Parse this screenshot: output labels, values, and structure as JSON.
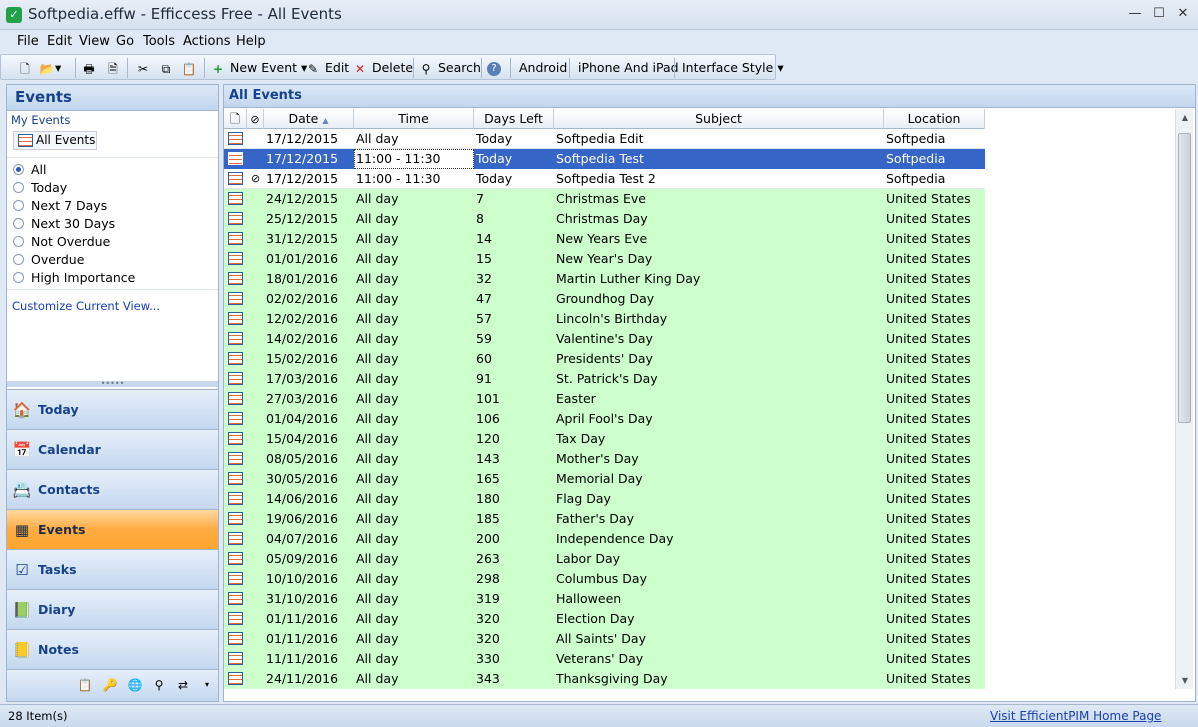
{
  "window": {
    "title": "Softpedia.effw - Efficcess Free - All Events",
    "app_icon": "check-icon",
    "controls": [
      "minimize-icon",
      "maximize-icon",
      "close-icon"
    ]
  },
  "menu": [
    "File",
    "Edit",
    "View",
    "Go",
    "Tools",
    "Actions",
    "Help"
  ],
  "toolbar": {
    "new_event": "New Event",
    "edit": "Edit",
    "delete": "Delete",
    "search": "Search",
    "android": "Android",
    "iphone": "iPhone And iPad",
    "interface_style": "Interface Style"
  },
  "sidebar": {
    "title": "Events",
    "my_events_label": "My Events",
    "all_events_label": "All Events",
    "filters": [
      {
        "label": "All",
        "selected": true
      },
      {
        "label": "Today",
        "selected": false
      },
      {
        "label": "Next 7 Days",
        "selected": false
      },
      {
        "label": "Next 30 Days",
        "selected": false
      },
      {
        "label": "Not Overdue",
        "selected": false
      },
      {
        "label": "Overdue",
        "selected": false
      },
      {
        "label": "High Importance",
        "selected": false
      }
    ],
    "customize_link": "Customize Current View..."
  },
  "navigation": [
    {
      "label": "Today",
      "icon": "home-icon",
      "active": false
    },
    {
      "label": "Calendar",
      "icon": "calendar-icon",
      "active": false
    },
    {
      "label": "Contacts",
      "icon": "contacts-icon",
      "active": false
    },
    {
      "label": "Events",
      "icon": "events-icon",
      "active": true
    },
    {
      "label": "Tasks",
      "icon": "tasks-icon",
      "active": false
    },
    {
      "label": "Diary",
      "icon": "diary-icon",
      "active": false
    },
    {
      "label": "Notes",
      "icon": "notes-icon",
      "active": false
    }
  ],
  "main": {
    "title": "All Events",
    "columns": [
      "Date",
      "Time",
      "Days Left",
      "Subject",
      "Location"
    ],
    "rows": [
      {
        "date": "17/12/2015",
        "time": "All day",
        "days_left": "Today",
        "subject": "Softpedia Edit",
        "location": "Softpedia",
        "style": "white",
        "attachment": false
      },
      {
        "date": "17/12/2015",
        "time": "11:00 - 11:30",
        "days_left": "Today",
        "subject": "Softpedia Test",
        "location": "Softpedia",
        "style": "sel",
        "attachment": false
      },
      {
        "date": "17/12/2015",
        "time": "11:00 - 11:30",
        "days_left": "Today",
        "subject": "Softpedia Test 2",
        "location": "Softpedia",
        "style": "white",
        "attachment": true
      },
      {
        "date": "24/12/2015",
        "time": "All day",
        "days_left": "7",
        "subject": "Christmas Eve",
        "location": "United States",
        "style": "green",
        "attachment": false
      },
      {
        "date": "25/12/2015",
        "time": "All day",
        "days_left": "8",
        "subject": "Christmas Day",
        "location": "United States",
        "style": "green",
        "attachment": false
      },
      {
        "date": "31/12/2015",
        "time": "All day",
        "days_left": "14",
        "subject": "New Years Eve",
        "location": "United States",
        "style": "green",
        "attachment": false
      },
      {
        "date": "01/01/2016",
        "time": "All day",
        "days_left": "15",
        "subject": "New Year's Day",
        "location": "United States",
        "style": "green",
        "attachment": false
      },
      {
        "date": "18/01/2016",
        "time": "All day",
        "days_left": "32",
        "subject": "Martin Luther King Day",
        "location": "United States",
        "style": "green",
        "attachment": false
      },
      {
        "date": "02/02/2016",
        "time": "All day",
        "days_left": "47",
        "subject": "Groundhog Day",
        "location": "United States",
        "style": "green",
        "attachment": false
      },
      {
        "date": "12/02/2016",
        "time": "All day",
        "days_left": "57",
        "subject": "Lincoln's Birthday",
        "location": "United States",
        "style": "green",
        "attachment": false
      },
      {
        "date": "14/02/2016",
        "time": "All day",
        "days_left": "59",
        "subject": "Valentine's Day",
        "location": "United States",
        "style": "green",
        "attachment": false
      },
      {
        "date": "15/02/2016",
        "time": "All day",
        "days_left": "60",
        "subject": "Presidents' Day",
        "location": "United States",
        "style": "green",
        "attachment": false
      },
      {
        "date": "17/03/2016",
        "time": "All day",
        "days_left": "91",
        "subject": "St. Patrick's Day",
        "location": "United States",
        "style": "green",
        "attachment": false
      },
      {
        "date": "27/03/2016",
        "time": "All day",
        "days_left": "101",
        "subject": "Easter",
        "location": "United States",
        "style": "green",
        "attachment": false
      },
      {
        "date": "01/04/2016",
        "time": "All day",
        "days_left": "106",
        "subject": "April Fool's Day",
        "location": "United States",
        "style": "green",
        "attachment": false
      },
      {
        "date": "15/04/2016",
        "time": "All day",
        "days_left": "120",
        "subject": "Tax Day",
        "location": "United States",
        "style": "green",
        "attachment": false
      },
      {
        "date": "08/05/2016",
        "time": "All day",
        "days_left": "143",
        "subject": "Mother's Day",
        "location": "United States",
        "style": "green",
        "attachment": false
      },
      {
        "date": "30/05/2016",
        "time": "All day",
        "days_left": "165",
        "subject": "Memorial Day",
        "location": "United States",
        "style": "green",
        "attachment": false
      },
      {
        "date": "14/06/2016",
        "time": "All day",
        "days_left": "180",
        "subject": "Flag Day",
        "location": "United States",
        "style": "green",
        "attachment": false
      },
      {
        "date": "19/06/2016",
        "time": "All day",
        "days_left": "185",
        "subject": "Father's Day",
        "location": "United States",
        "style": "green",
        "attachment": false
      },
      {
        "date": "04/07/2016",
        "time": "All day",
        "days_left": "200",
        "subject": "Independence Day",
        "location": "United States",
        "style": "green",
        "attachment": false
      },
      {
        "date": "05/09/2016",
        "time": "All day",
        "days_left": "263",
        "subject": "Labor Day",
        "location": "United States",
        "style": "green",
        "attachment": false
      },
      {
        "date": "10/10/2016",
        "time": "All day",
        "days_left": "298",
        "subject": "Columbus Day",
        "location": "United States",
        "style": "green",
        "attachment": false
      },
      {
        "date": "31/10/2016",
        "time": "All day",
        "days_left": "319",
        "subject": "Halloween",
        "location": "United States",
        "style": "green",
        "attachment": false
      },
      {
        "date": "01/11/2016",
        "time": "All day",
        "days_left": "320",
        "subject": "Election Day",
        "location": "United States",
        "style": "green",
        "attachment": false
      },
      {
        "date": "01/11/2016",
        "time": "All day",
        "days_left": "320",
        "subject": "All Saints' Day",
        "location": "United States",
        "style": "green",
        "attachment": false
      },
      {
        "date": "11/11/2016",
        "time": "All day",
        "days_left": "330",
        "subject": "Veterans' Day",
        "location": "United States",
        "style": "green",
        "attachment": false
      },
      {
        "date": "24/11/2016",
        "time": "All day",
        "days_left": "343",
        "subject": "Thanksgiving Day",
        "location": "United States",
        "style": "green",
        "attachment": false
      }
    ]
  },
  "status": {
    "count": "28 Item(s)",
    "link": "Visit EfficientPIM Home Page"
  },
  "colors": {
    "row_green": "#ccffcc",
    "row_selected": "#3565c6",
    "nav_active": "#ffac42",
    "header_text": "#15428b"
  }
}
